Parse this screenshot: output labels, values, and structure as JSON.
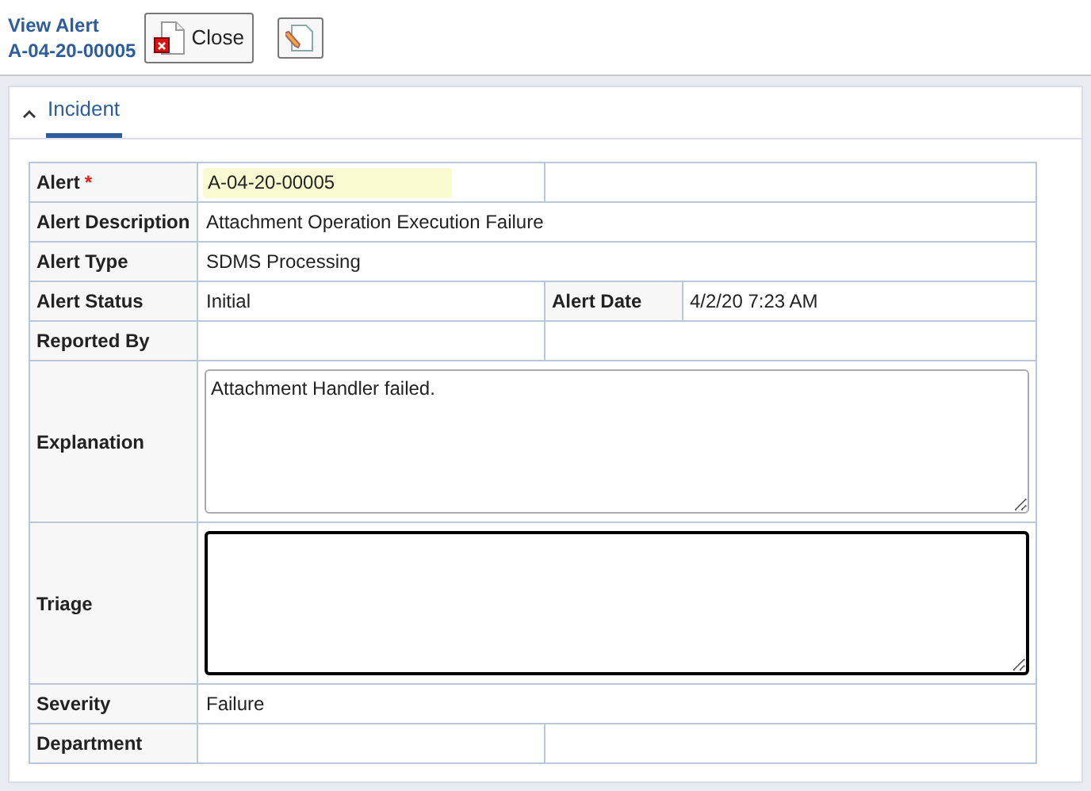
{
  "header": {
    "title": "View Alert",
    "record_id": "A-04-20-00005",
    "close_button": "Close"
  },
  "section": {
    "tab": "Incident"
  },
  "rows": [
    {
      "kind": "input_split",
      "label": "Alert",
      "required_mark": "*",
      "value": "A-04-20-00005"
    },
    {
      "kind": "full",
      "label": "Alert Description",
      "value": "Attachment Operation Execution Failure"
    },
    {
      "kind": "full",
      "label": "Alert Type",
      "value": "SDMS Processing"
    },
    {
      "kind": "split",
      "label": "Alert Status",
      "value": "Initial",
      "label_2": "Alert Date",
      "value_2": "4/2/20 7:23 AM"
    },
    {
      "kind": "split",
      "label": "Reported By"
    },
    {
      "kind": "textarea",
      "label": "Explanation",
      "value": "Attachment Handler failed.",
      "focused": false
    },
    {
      "kind": "textarea",
      "label": "Triage",
      "focused": true
    },
    {
      "kind": "full",
      "label": "Severity",
      "value": "Failure"
    },
    {
      "kind": "split",
      "label": "Department"
    }
  ]
}
